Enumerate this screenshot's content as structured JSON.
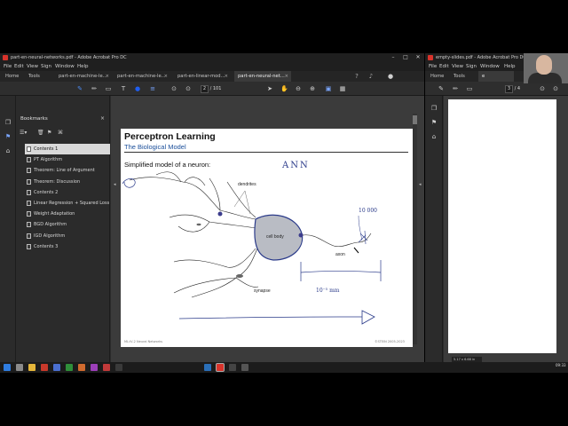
{
  "main_window": {
    "title": "part-en-neural-networks.pdf - Adobe Acrobat Pro DC",
    "menu": [
      "File",
      "Edit",
      "View",
      "Sign",
      "Window",
      "Help"
    ],
    "nav": [
      "Home",
      "Tools"
    ],
    "tabs": [
      "part-en-machine-le...",
      "part-en-machine-le...",
      "part-en-linear-mod...",
      "part-en-neural-net..."
    ],
    "page_current": "2",
    "page_total": "/ 101",
    "bookmarks_title": "Bookmarks",
    "bookmarks": [
      "Contents 1",
      "PT Algorithm",
      "Theorem: Line of Argument",
      "Theorem: Discussion",
      "Contents 2",
      "Linear Regression + Squared Loss",
      "Weight Adaptation",
      "BGD Algorithm",
      "IGD Algorithm",
      "Contents 3"
    ]
  },
  "slide": {
    "title": "Perceptron Learning",
    "subtitle": "The Biological Model",
    "text": "Simplified model of a neuron:",
    "labels": {
      "dendrites": "dendrites",
      "cell_body": "cell body",
      "axon": "axon",
      "synapse": "synapse"
    },
    "handwriting": {
      "ann": "ANN",
      "count": "10 000",
      "scale": "10⁻⁵ mm"
    },
    "footer_left": "ML:IV-2   Neural Networks",
    "footer_right": "©STEIN 2005-2023"
  },
  "second_window": {
    "title": "empty-slides.pdf - Adobe Acrobat Pro DC",
    "menu": [
      "File",
      "Edit",
      "View",
      "Sign",
      "Window",
      "Help"
    ],
    "nav": [
      "Home",
      "Tools"
    ],
    "page_current": "3",
    "page_total": "/ 4",
    "page_size": "5.17 x 6.68 in"
  },
  "taskbar": {
    "time": "09:33"
  },
  "colors": {
    "accent_blue": "#1a4e9a",
    "cell_fill": "#b9bcc4",
    "acrobat_red": "#d8332b"
  }
}
